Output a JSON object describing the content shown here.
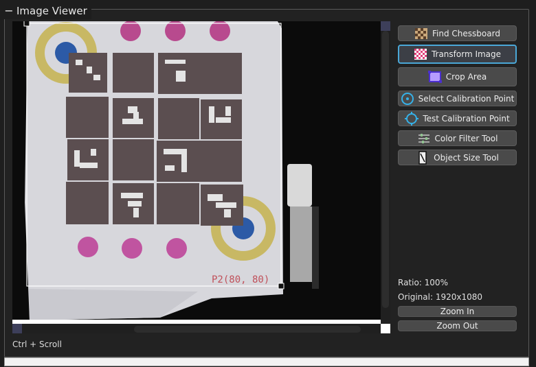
{
  "panel": {
    "title": "Image Viewer",
    "collapse_symbol": "−"
  },
  "image": {
    "point_label": "P2(80, 80)"
  },
  "hint": {
    "text": "Ctrl + Scroll"
  },
  "tools": [
    {
      "label": "Find Chessboard",
      "icon": "chessboard-icon"
    },
    {
      "label": "Transform Image",
      "icon": "checker-pink-icon",
      "active": true
    },
    {
      "label": "Crop Area",
      "icon": "crop-icon"
    },
    {
      "label": "Select Calibration Point",
      "icon": "target-icon"
    },
    {
      "label": "Test Calibration Point",
      "icon": "crosshair-circle-icon"
    },
    {
      "label": "Color Filter Tool",
      "icon": "sliders-icon"
    },
    {
      "label": "Object Size Tool",
      "icon": "ruler-icon"
    }
  ],
  "info": {
    "ratio": "Ratio: 100%",
    "original": "Original: 1920x1080"
  },
  "zoom": {
    "zoom_in": "Zoom In",
    "zoom_out": "Zoom Out"
  },
  "colors": {
    "accent": "#4aa8d8",
    "button_bg": "#4a4a4a",
    "marker_magenta": "#c04a96",
    "marker_blue": "#2c5aa6",
    "marker_yellow": "#cdbb60"
  }
}
